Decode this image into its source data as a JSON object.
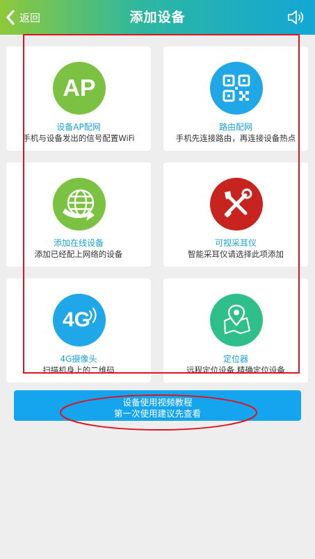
{
  "header": {
    "back_label": "返回",
    "title": "添加设备"
  },
  "cards": [
    {
      "name": "设备AP配网",
      "desc": "手机与设备发出的信号配置WiFi",
      "icon": "ap-icon",
      "icon_text": "AP",
      "color": "#7cc242"
    },
    {
      "name": "路由配网",
      "desc": "手机先连接路由，再连接设备热点",
      "icon": "qr-code-icon",
      "color": "#1fa7e8"
    },
    {
      "name": "添加在线设备",
      "desc": "添加已经配上网络的设备",
      "icon": "globe-icon",
      "color": "#7cc242"
    },
    {
      "name": "可视采耳仪",
      "desc": "智能采耳仪请选择此项添加",
      "icon": "tools-icon",
      "color": "#c8241f"
    },
    {
      "name": "4G摄像头",
      "desc": "扫描机身上的二维码",
      "icon": "4g-icon",
      "icon_text": "4G",
      "color": "#1fa7e8"
    },
    {
      "name": "定位器",
      "desc": "远程定位设备,精确定位设备",
      "icon": "map-pin-icon",
      "color": "#2fbf8a"
    }
  ],
  "tutorial": {
    "line1": "设备使用视频教程",
    "line2": "第一次使用建议先查看"
  },
  "colors": {
    "header_start": "#8fc93a",
    "header_end": "#12a7d6",
    "tutorial_button": "#14a5ee",
    "annotation": "#e0141e"
  }
}
